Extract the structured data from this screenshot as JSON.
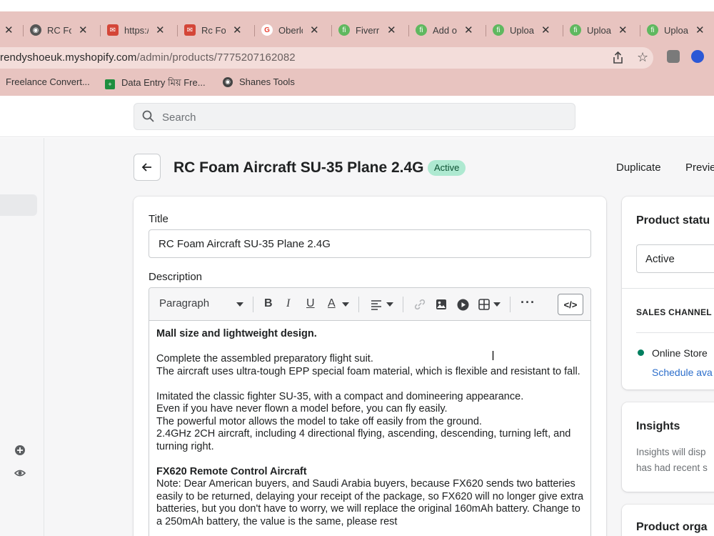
{
  "browser": {
    "tabs": [
      {
        "label": "",
        "favicon": "close-only",
        "color": "#e8c4c0"
      },
      {
        "label": "RC Foam Aircraft",
        "favicon": "globe-icon",
        "color": "#555555"
      },
      {
        "label": "https://",
        "favicon": "mail-icon",
        "color": "#d44638"
      },
      {
        "label": "Rc Foam",
        "favicon": "mail-icon",
        "color": "#d44638"
      },
      {
        "label": "Oberlo",
        "favicon": "google-icon",
        "color": "#ea4335"
      },
      {
        "label": "Fiverr",
        "favicon": "fiverr-icon",
        "color": "#5fb85f"
      },
      {
        "label": "Add on",
        "favicon": "fiverr-icon",
        "color": "#5fb85f"
      },
      {
        "label": "Upload",
        "favicon": "fiverr-icon",
        "color": "#5fb85f"
      },
      {
        "label": "Upload",
        "favicon": "fiverr-icon",
        "color": "#5fb85f"
      },
      {
        "label": "Upload",
        "favicon": "fiverr-icon",
        "color": "#5fb85f"
      }
    ],
    "url_host": "rendyshoeuk.myshopify.com",
    "url_path": "/admin/products/7775207162082",
    "bookmarks": [
      {
        "label": "Freelance Convert...",
        "icon": "none"
      },
      {
        "label": "Data Entry মিয় Fre...",
        "icon": "sheets-icon"
      },
      {
        "label": "Shanes Tools",
        "icon": "globe-icon"
      }
    ]
  },
  "admin": {
    "search_placeholder": "Search",
    "page_title": "RC Foam Aircraft SU-35 Plane 2.4G",
    "status_badge": "Active",
    "actions": {
      "duplicate": "Duplicate",
      "preview": "Previe"
    },
    "title_label": "Title",
    "title_value": "RC Foam Aircraft SU-35 Plane 2.4G",
    "description_label": "Description",
    "toolbar": {
      "paragraph": "Paragraph",
      "code": "</>"
    },
    "description": {
      "heading": "Mall size and lightweight design.",
      "p1": [
        "Complete the assembled preparatory flight suit.",
        "The aircraft uses ultra-tough EPP special foam material, which is flexible and resistant to fall."
      ],
      "p2": [
        "Imitated the classic fighter SU-35, with a compact and domineering appearance.",
        "Even if you have never flown a model before, you can fly easily.",
        "The powerful motor allows the model to take off easily from the ground.",
        "2.4GHz 2CH aircraft, including 4 directional flying, ascending, descending, turning left, and turning right."
      ],
      "subheading": "FX620 Remote Control Aircraft",
      "p3": "Note: Dear American buyers, and Saudi Arabia buyers, because FX620 sends two batteries easily to be returned, delaying your receipt of the package, so FX620 will no longer give extra batteries, but you don't have to worry, we will replace the original 160mAh battery. Change to a 250mAh battery, the value is the same, please rest"
    },
    "side": {
      "product_status_title": "Product statu",
      "status_value": "Active",
      "sales_channels": "SALES CHANNEL",
      "online_store": "Online Store",
      "schedule": "Schedule ava",
      "insights_title": "Insights",
      "insights_text_1": "Insights will disp",
      "insights_text_2": "has had recent s",
      "org_title": "Product orga"
    }
  },
  "colors": {
    "chrome": "#e8c4c0",
    "badge_bg": "#aee9d1",
    "badge_fg": "#0c5132",
    "link": "#2c6ecb",
    "online_dot": "#007f5f"
  }
}
